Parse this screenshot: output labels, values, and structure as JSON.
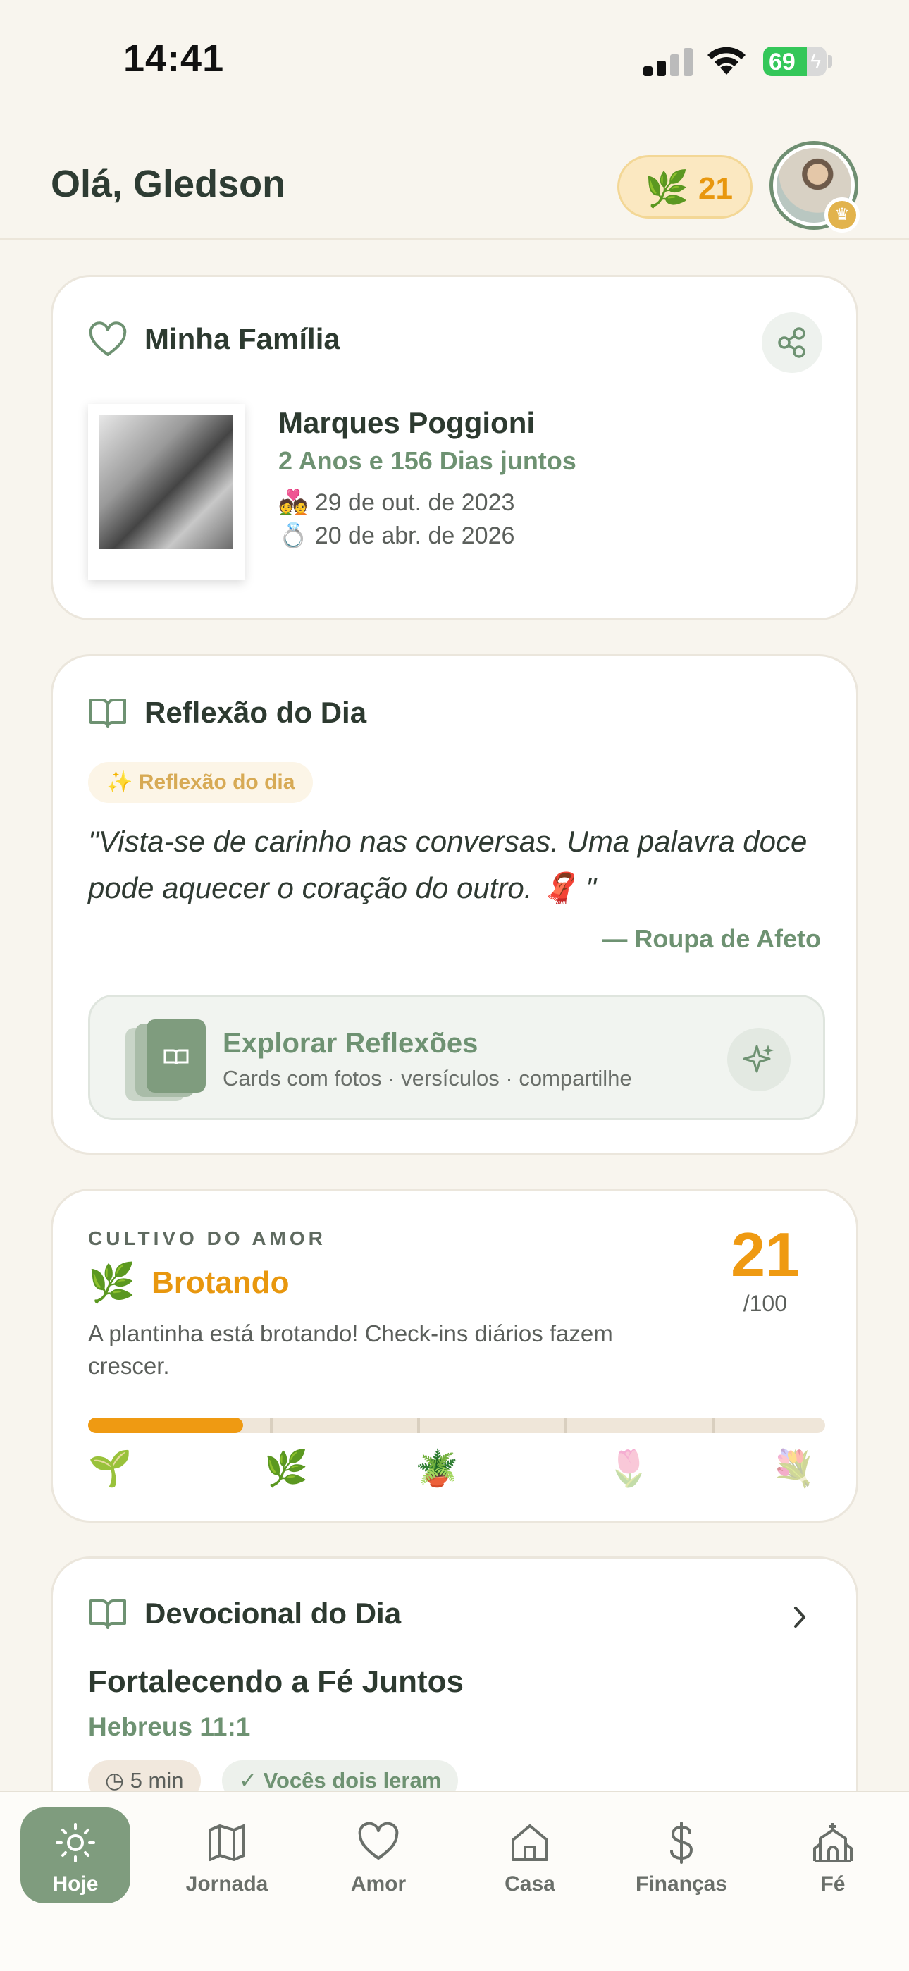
{
  "status_bar": {
    "time": "14:41",
    "battery_percent": "69",
    "battery_level": 0.69
  },
  "header": {
    "greeting": "Olá, Gledson",
    "points": "21"
  },
  "family_card": {
    "title": "Minha Família",
    "couple_name": "Marques Poggioni",
    "together": "2 Anos e 156 Dias juntos",
    "date_1": "29 de out. de 2023",
    "date_1_emoji": "💑",
    "date_2": "20 de abr. de 2026",
    "date_2_emoji": "💍"
  },
  "reflection_card": {
    "title": "Reflexão do Dia",
    "tag": "✨ Reflexão do dia",
    "quote": "\"Vista-se de carinho nas conversas. Uma palavra doce pode aquecer o coração do outro. 🧣 \"",
    "author": "— Roupa de Afeto",
    "explore_title": "Explorar Reflexões",
    "explore_subtitle": "Cards com fotos · versículos · compartilhe"
  },
  "cultivo_card": {
    "eyebrow": "CULTIVO DO AMOR",
    "stage_emoji": "🌿",
    "stage": "Brotando",
    "description": "A plantinha está brotando! Check-ins diários fazem crescer.",
    "score": "21",
    "max": "/100",
    "progress": 0.21,
    "stage_icons": [
      "🌱",
      "🌿",
      "🪴",
      "🌷",
      "💐"
    ]
  },
  "devotional_card": {
    "title": "Devocional do Dia",
    "heading": "Fortalecendo a Fé Juntos",
    "reference": "Hebreus 11:1",
    "duration": "5 min",
    "status": "✓ Vocês dois leram"
  },
  "tabs": [
    {
      "label": "Hoje",
      "icon": "sun-icon",
      "active": true
    },
    {
      "label": "Jornada",
      "icon": "map-icon",
      "active": false
    },
    {
      "label": "Amor",
      "icon": "heart-icon",
      "active": false
    },
    {
      "label": "Casa",
      "icon": "home-icon",
      "active": false
    },
    {
      "label": "Finanças",
      "icon": "dollar-icon",
      "active": false
    },
    {
      "label": "Fé",
      "icon": "church-icon",
      "active": false
    }
  ],
  "colors": {
    "background": "#f8f5ee",
    "accent_green": "#6e9272",
    "accent_orange": "#ef9a12",
    "tab_active": "#7f9c7e"
  }
}
